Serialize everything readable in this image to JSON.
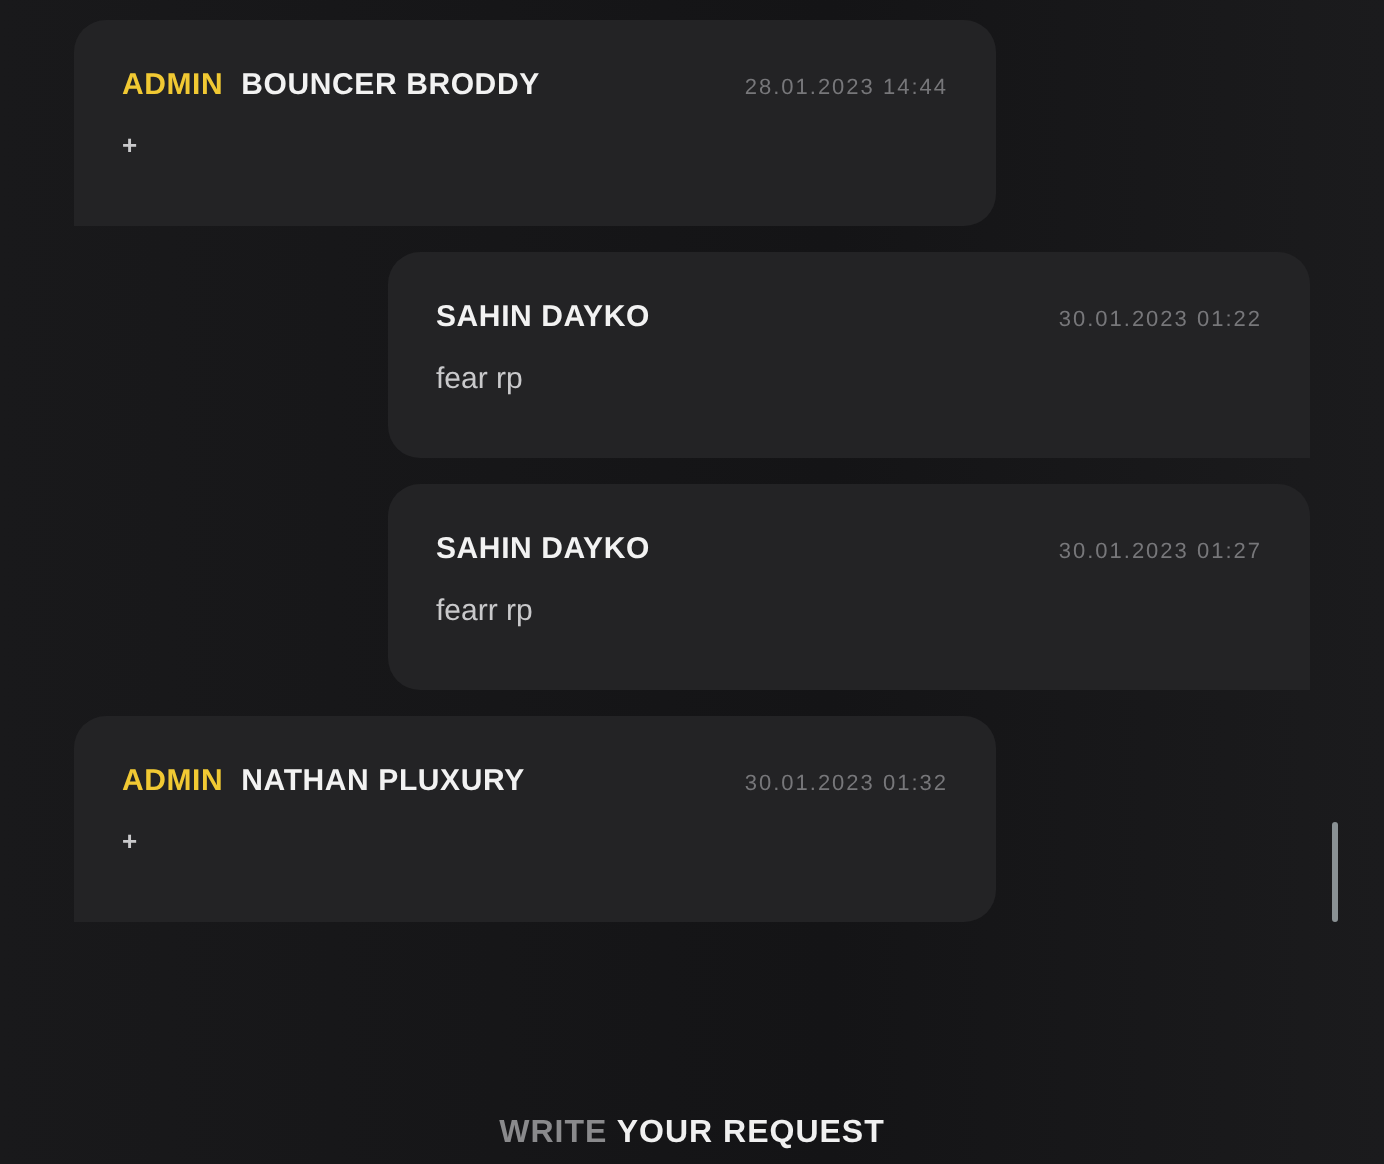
{
  "messages": [
    {
      "kind": "admin",
      "role": "ADMIN",
      "author": "BOUNCER BRODDY",
      "time": "28.01.2023 14:44",
      "text": "+"
    },
    {
      "kind": "user",
      "author": "SAHIN DAYKO",
      "time": "30.01.2023 01:22",
      "text": "fear rp"
    },
    {
      "kind": "user",
      "author": "SAHIN DAYKO",
      "time": "30.01.2023 01:27",
      "text": "fearr rp"
    },
    {
      "kind": "admin",
      "role": "ADMIN",
      "author": "NATHAN PLUXURY",
      "time": "30.01.2023 01:32",
      "text": "+"
    }
  ],
  "request_button": {
    "prefix": "WRITE",
    "label": "YOUR REQUEST"
  }
}
